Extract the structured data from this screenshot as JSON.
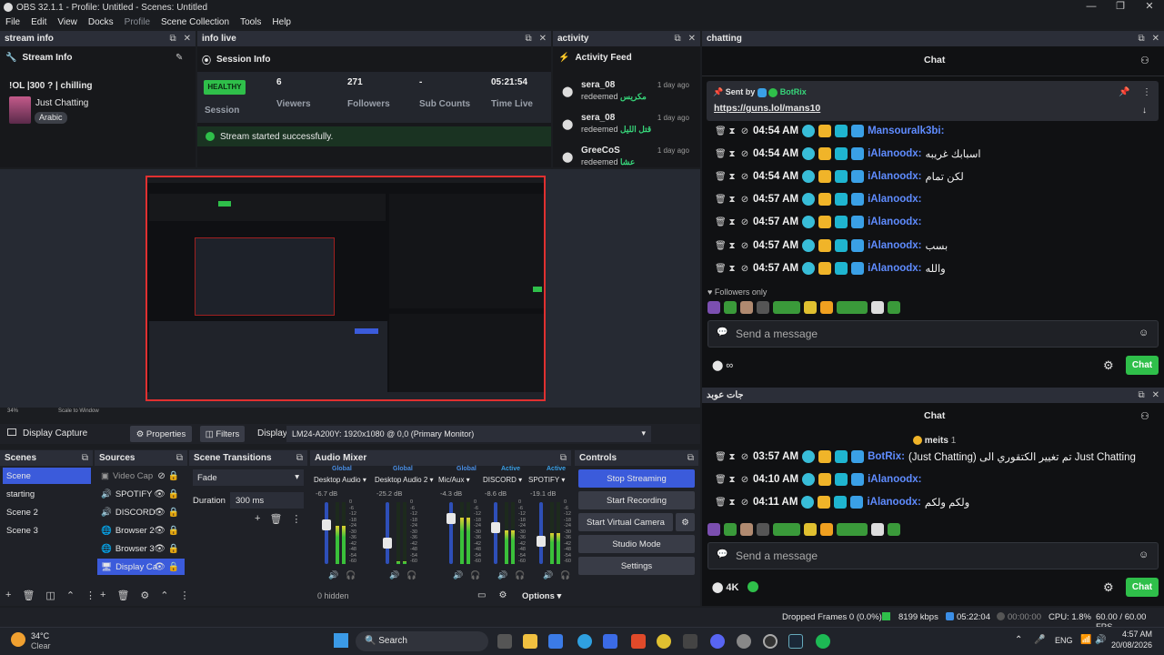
{
  "window": {
    "title": "OBS 32.1.1 - Profile: Untitled - Scenes: Untitled",
    "controls": [
      "—",
      "❐",
      "✕"
    ]
  },
  "menu": [
    "File",
    "Edit",
    "View",
    "Docks",
    "Profile",
    "Scene Collection",
    "Tools",
    "Help"
  ],
  "stream_info": {
    "dock_title": "stream info",
    "header": "Stream Info",
    "title": "!OL |300 ? | chilling",
    "category": "Just Chatting",
    "tag": "Arabic"
  },
  "info_live": {
    "dock_title": "info live",
    "header": "Session Info",
    "health": "HEALTHY",
    "session_label": "Session",
    "stats": [
      {
        "value": "6",
        "label": "Viewers"
      },
      {
        "value": "271",
        "label": "Followers"
      },
      {
        "value": "-",
        "label": "Sub Counts"
      },
      {
        "value": "05:21:54",
        "label": "Time Live"
      }
    ],
    "status": "Stream started successfully."
  },
  "activity": {
    "dock_title": "activity",
    "header": "Activity Feed",
    "items": [
      {
        "name": "sera_08",
        "action": "redeemed",
        "reward": "مكريس",
        "time": "1 day ago"
      },
      {
        "name": "sera_08",
        "action": "redeemed",
        "reward": "قتل الليل",
        "time": "1 day ago"
      },
      {
        "name": "GreeCoS",
        "action": "redeemed",
        "reward": "عشا",
        "time": "1 day ago"
      }
    ]
  },
  "chat1": {
    "dock_title": "chatting",
    "header": "Chat",
    "pinned_by": "Sent by",
    "pinned_user": "BotRix",
    "pinned_link": "https://guns.lol/mans10",
    "lines": [
      {
        "time": "04:54 AM",
        "user": "Mansouralk3bi:",
        "msg": ""
      },
      {
        "time": "04:54 AM",
        "user": "iAlanoodx:",
        "msg": "اسبابك غريبه"
      },
      {
        "time": "04:54 AM",
        "user": "iAlanoodx:",
        "msg": "لكن تمام"
      },
      {
        "time": "04:57 AM",
        "user": "iAlanoodx:",
        "msg": ""
      },
      {
        "time": "04:57 AM",
        "user": "iAlanoodx:",
        "msg": ""
      },
      {
        "time": "04:57 AM",
        "user": "iAlanoodx:",
        "msg": "بسب"
      },
      {
        "time": "04:57 AM",
        "user": "iAlanoodx:",
        "msg": "والله"
      }
    ],
    "followers_only": "Followers only",
    "placeholder": "Send a message",
    "viewers": "∞",
    "chat_button": "Chat"
  },
  "chat2": {
    "dock_title": "جات عوبد",
    "header": "Chat",
    "meits": "meits",
    "meits_count": "1",
    "lines": [
      {
        "time": "03:57 AM",
        "user": "BotRix:",
        "msg": "(Just Chatting) تم تغيير الكتقوري الى Just Chatting"
      },
      {
        "time": "04:10 AM",
        "user": "iAlanoodx:",
        "msg": ""
      },
      {
        "time": "04:11 AM",
        "user": "iAlanoodx:",
        "msg": "ولكم ولكم"
      }
    ],
    "placeholder": "Send a message",
    "viewers": "4K",
    "chat_button": "Chat"
  },
  "preview": {
    "zoom": "34%",
    "scale_label": "Scale to Window"
  },
  "source_bar": {
    "source": "Display Capture",
    "properties": "Properties",
    "filters": "Filters",
    "display_label": "Display",
    "display_value": "LM24-A200Y: 1920x1080 @ 0,0 (Primary Monitor)"
  },
  "scenes": {
    "title": "Scenes",
    "items": [
      "Scene",
      "starting",
      "Scene 2",
      "Scene 3"
    ]
  },
  "sources": {
    "title": "Sources",
    "items": [
      "Video Cap",
      "SPOTIFY",
      "DISCORD",
      "Browser 2",
      "Browser 3",
      "Display Ca"
    ]
  },
  "transitions": {
    "title": "Scene Transitions",
    "type": "Fade",
    "duration_label": "Duration",
    "duration": "300 ms"
  },
  "mixer": {
    "title": "Audio Mixer",
    "hidden": "0 hidden",
    "options": "Options",
    "channels": [
      {
        "scope": "Global",
        "name": "Desktop Audio",
        "db": "-6.7 dB",
        "level": 0.62,
        "fader": 0.72
      },
      {
        "scope": "Global",
        "name": "Desktop Audio 2",
        "db": "-25.2 dB",
        "level": 0.05,
        "fader": 0.43
      },
      {
        "scope": "Global",
        "name": "Mic/Aux",
        "db": "-4.3 dB",
        "level": 0.75,
        "fader": 0.82
      },
      {
        "scope": "Active",
        "name": "DISCORD",
        "db": "-8.6 dB",
        "level": 0.55,
        "fader": 0.68
      },
      {
        "scope": "Active",
        "name": "SPOTIFY",
        "db": "-19.1 dB",
        "level": 0.5,
        "fader": 0.45
      }
    ],
    "ticks": [
      "0",
      "-6",
      "-12",
      "-18",
      "-24",
      "-30",
      "-36",
      "-42",
      "-48",
      "-54",
      "-60"
    ]
  },
  "controls": {
    "title": "Controls",
    "stop_streaming": "Stop Streaming",
    "start_recording": "Start Recording",
    "virtual_camera": "Start Virtual Camera",
    "studio_mode": "Studio Mode",
    "settings": "Settings"
  },
  "status": {
    "dropped": "Dropped Frames 0 (0.0%)",
    "kbps": "8199 kbps",
    "live_time": "05:22:04",
    "rec_time": "00:00:00",
    "cpu": "CPU: 1.8%",
    "fps": "60.00 / 60.00 FPS"
  },
  "taskbar": {
    "temp": "34°C",
    "weather": "Clear",
    "search": "Search",
    "lang": "ENG",
    "time": "4:57 AM",
    "date": "20/08/2026"
  }
}
